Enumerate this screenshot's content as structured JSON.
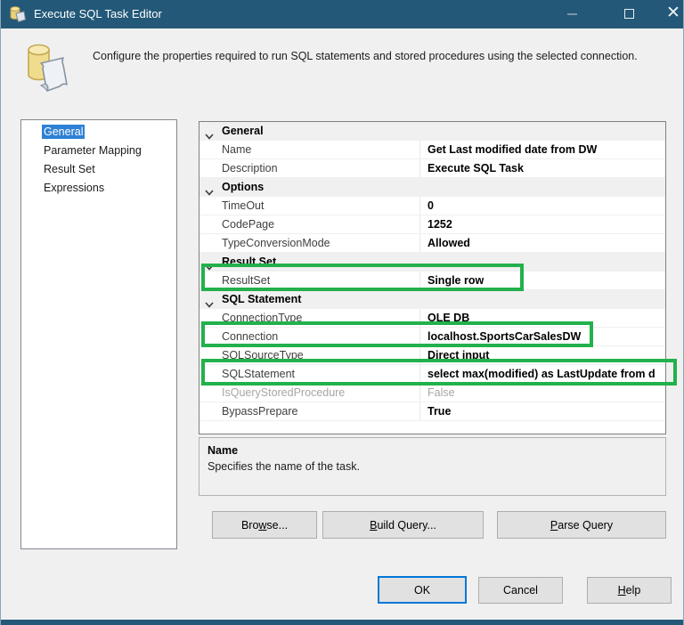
{
  "window": {
    "title": "Execute SQL Task Editor"
  },
  "header": {
    "description": "Configure the properties required to run SQL statements and stored procedures using the selected connection."
  },
  "nav": {
    "items": [
      {
        "label": "General",
        "selected": true
      },
      {
        "label": "Parameter Mapping",
        "selected": false
      },
      {
        "label": "Result Set",
        "selected": false
      },
      {
        "label": "Expressions",
        "selected": false
      }
    ]
  },
  "grid": {
    "rows": [
      {
        "type": "category",
        "label": "General"
      },
      {
        "type": "prop",
        "label": "Name",
        "value": "Get Last modified date from DW"
      },
      {
        "type": "prop",
        "label": "Description",
        "value": "Execute SQL Task"
      },
      {
        "type": "category",
        "label": "Options"
      },
      {
        "type": "prop",
        "label": "TimeOut",
        "value": "0"
      },
      {
        "type": "prop",
        "label": "CodePage",
        "value": "1252"
      },
      {
        "type": "prop",
        "label": "TypeConversionMode",
        "value": "Allowed"
      },
      {
        "type": "category",
        "label": "Result Set"
      },
      {
        "type": "prop",
        "label": "ResultSet",
        "value": "Single row",
        "highlighted": true
      },
      {
        "type": "category",
        "label": "SQL Statement"
      },
      {
        "type": "prop",
        "label": "ConnectionType",
        "value": "OLE DB"
      },
      {
        "type": "prop",
        "label": "Connection",
        "value": "localhost.SportsCarSalesDW",
        "highlighted": true
      },
      {
        "type": "prop",
        "label": "SQLSourceType",
        "value": "Direct input"
      },
      {
        "type": "prop",
        "label": "SQLStatement",
        "value": "select max(modified) as LastUpdate from d",
        "highlighted": true
      },
      {
        "type": "prop",
        "label": "IsQueryStoredProcedure",
        "value": "False",
        "disabled": true
      },
      {
        "type": "prop",
        "label": "BypassPrepare",
        "value": "True"
      }
    ]
  },
  "info_panel": {
    "title": "Name",
    "text": "Specifies the name of the task."
  },
  "action_buttons": {
    "browse": {
      "pre": "Bro",
      "key": "w",
      "post": "se..."
    },
    "build_query": {
      "pre": "",
      "key": "B",
      "post": "uild Query..."
    },
    "parse_query": {
      "pre": "",
      "key": "P",
      "post": "arse Query"
    }
  },
  "dialog_buttons": {
    "ok": "OK",
    "cancel": "Cancel",
    "help": {
      "pre": "",
      "key": "H",
      "post": "elp"
    }
  },
  "colors": {
    "titlebar": "#235878",
    "selection_blue": "#2e80d4",
    "highlight_green": "#22b14c",
    "ok_focus_border": "#0078d7"
  }
}
